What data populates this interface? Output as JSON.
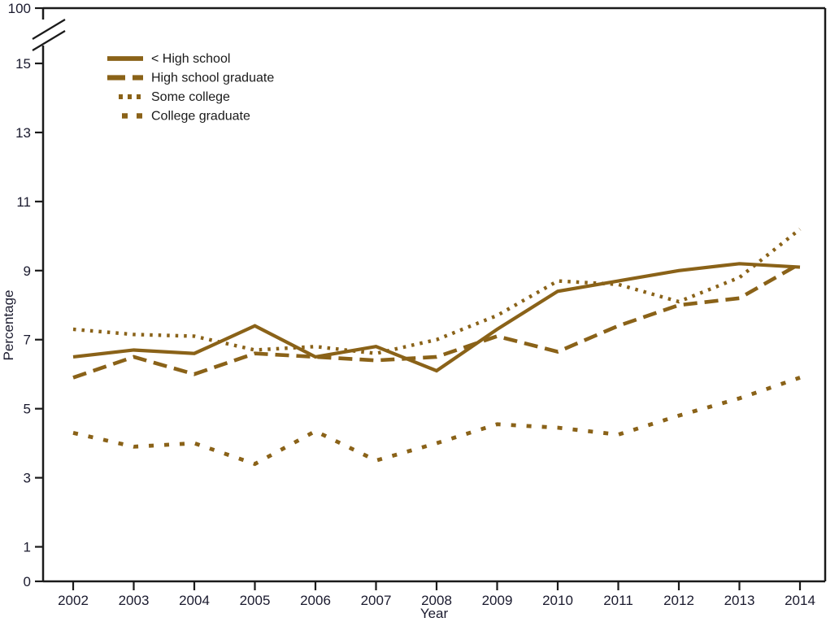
{
  "chart_data": {
    "type": "line",
    "title": "",
    "xlabel": "Year",
    "ylabel": "Percentage",
    "grid": false,
    "legend_position": "top-left",
    "axis_break": true,
    "axis_break_note": "y-axis broken between 15 and 100",
    "categories": [
      2002,
      2003,
      2004,
      2005,
      2006,
      2007,
      2008,
      2009,
      2010,
      2011,
      2012,
      2013,
      2014
    ],
    "x": [
      "2002",
      "2003",
      "2004",
      "2005",
      "2006",
      "2007",
      "2008",
      "2009",
      "2010",
      "2011",
      "2012",
      "2013",
      "2014"
    ],
    "xlim": [
      2002,
      2014
    ],
    "ylim": [
      0,
      15
    ],
    "yticks": [
      "0",
      "1",
      "3",
      "5",
      "7",
      "9",
      "11",
      "13",
      "15",
      "100"
    ],
    "ytick_values": [
      0,
      1,
      3,
      5,
      7,
      9,
      11,
      13,
      15,
      100
    ],
    "xticks": [
      "2002",
      "2003",
      "2004",
      "2005",
      "2006",
      "2007",
      "2008",
      "2009",
      "2010",
      "2011",
      "2012",
      "2013",
      "2014"
    ],
    "series": [
      {
        "name": "< High school",
        "style": "solid",
        "color": "#8a6218",
        "values": [
          6.5,
          6.7,
          6.6,
          7.4,
          6.5,
          6.8,
          6.1,
          7.3,
          8.4,
          8.7,
          9.0,
          9.2,
          9.1
        ]
      },
      {
        "name": "High school graduate",
        "style": "dashed",
        "color": "#8a6218",
        "values": [
          5.9,
          6.5,
          6.0,
          6.6,
          6.5,
          6.4,
          6.5,
          7.1,
          6.65,
          7.4,
          8.0,
          8.2,
          9.2
        ]
      },
      {
        "name": "Some college",
        "style": "dotted-fine",
        "color": "#8a6218",
        "values": [
          7.3,
          7.15,
          7.1,
          6.7,
          6.8,
          6.6,
          7.0,
          7.7,
          8.7,
          8.6,
          8.1,
          8.8,
          10.2
        ]
      },
      {
        "name": "College graduate",
        "style": "dotted-coarse",
        "color": "#8a6218",
        "values": [
          4.3,
          3.9,
          4.0,
          3.4,
          4.35,
          3.5,
          4.0,
          4.55,
          4.45,
          4.25,
          4.8,
          5.3,
          5.9
        ]
      }
    ]
  },
  "legend": {
    "items": [
      {
        "label": "< High school",
        "style": "solid"
      },
      {
        "label": "High school graduate",
        "style": "dashed"
      },
      {
        "label": "Some college",
        "style": "dotted-fine"
      },
      {
        "label": "College graduate",
        "style": "dotted-coarse"
      }
    ]
  },
  "colors": {
    "series": "#8a6218",
    "axis": "#1a1a1a",
    "tick_text": "#1a1a2e"
  }
}
